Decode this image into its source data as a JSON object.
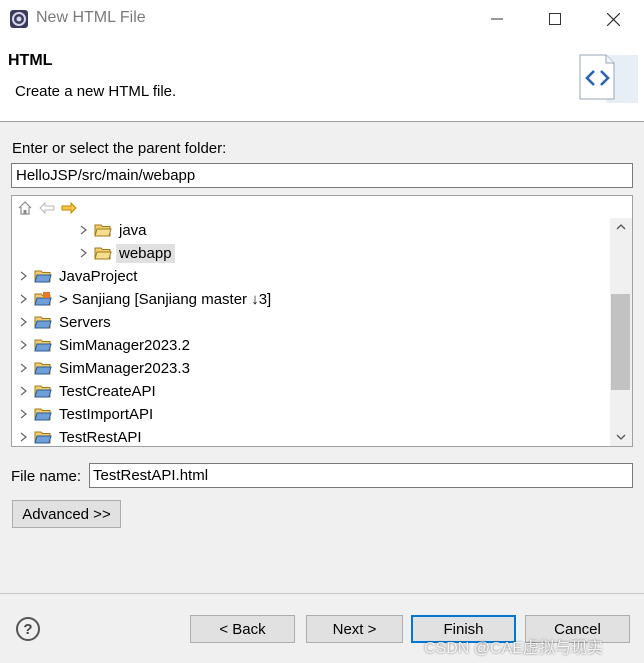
{
  "window": {
    "title": "New HTML File"
  },
  "header": {
    "title": "HTML",
    "description": "Create a new HTML file."
  },
  "folder": {
    "label": "Enter or select the parent folder:",
    "value": "HelloJSP/src/main/webapp"
  },
  "tree": {
    "toolbar": [
      "home-icon",
      "back-arrow-icon",
      "forward-arrow-icon"
    ],
    "items": [
      {
        "label": "java",
        "selected": false
      },
      {
        "label": "webapp",
        "selected": true
      },
      {
        "label": "JavaProject",
        "selected": false
      },
      {
        "label": "> Sanjiang [Sanjiang master ↓3]",
        "selected": false
      },
      {
        "label": "Servers",
        "selected": false
      },
      {
        "label": "SimManager2023.2",
        "selected": false
      },
      {
        "label": "SimManager2023.3",
        "selected": false
      },
      {
        "label": "TestCreateAPI",
        "selected": false
      },
      {
        "label": "TestImportAPI",
        "selected": false
      },
      {
        "label": "TestRestAPI",
        "selected": false
      }
    ]
  },
  "file": {
    "label": "File name:",
    "value": "TestRestAPI.html"
  },
  "buttons": {
    "advanced": "Advanced >>",
    "help": "?",
    "back": "< Back",
    "next": "Next >",
    "finish": "Finish",
    "cancel": "Cancel"
  },
  "watermark": "CSDN @CAE虚拟与现实",
  "colors": {
    "accent": "#0078d7",
    "folder": "#e6b84a",
    "selection": "#e0e0e0"
  }
}
